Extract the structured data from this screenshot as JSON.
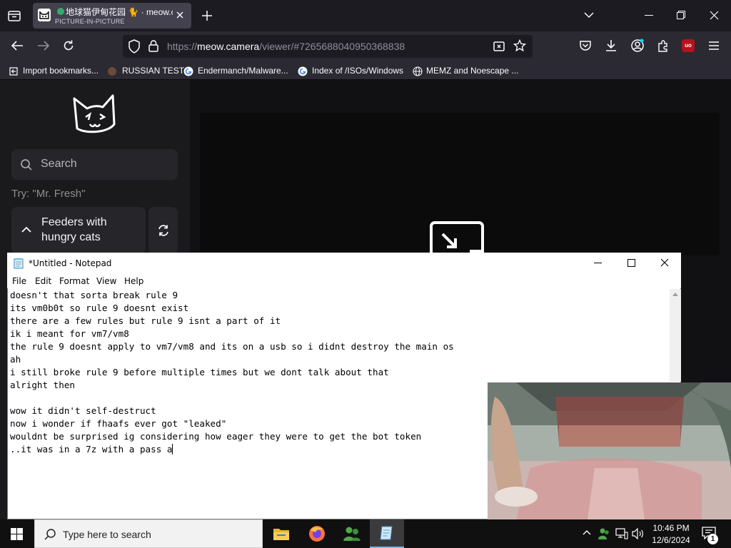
{
  "browser": {
    "tab": {
      "title": "地球猫伊甸花园 🐈 · meow.c",
      "subtitle": "PICTURE-IN-PICTURE"
    },
    "url": {
      "prefix": "https://",
      "host": "meow.camera",
      "path": "/viewer/#7265688040950368838"
    },
    "bookmarks": [
      {
        "label": "Import bookmarks...",
        "icon": "import-icon"
      },
      {
        "label": "RUSSIAN TEST",
        "icon": "globe-icon"
      },
      {
        "label": "Endermanch/Malware...",
        "icon": "google-icon"
      },
      {
        "label": "Index of /ISOs/Windows",
        "icon": "google-icon"
      },
      {
        "label": "MEMZ and Noescape ...",
        "icon": "globe-icon"
      }
    ]
  },
  "site": {
    "search_placeholder": "Search",
    "hint": "Try: \"Mr. Fresh\"",
    "feeders_label": "Feeders with hungry cats"
  },
  "notepad": {
    "title": "*Untitled - Notepad",
    "menu": [
      "File",
      "Edit",
      "Format",
      "View",
      "Help"
    ],
    "lines": [
      "doesn't that sorta break rule 9",
      "its vm0b0t so rule 9 doesnt exist",
      "there are a few rules but rule 9 isnt a part of it",
      "ik i meant for vm7/vm8",
      "the rule 9 doesnt apply to vm7/vm8 and its on a usb so i didnt destroy the main os",
      "ah",
      "i still broke rule 9 before multiple times but we dont talk about that",
      "alright then",
      "",
      "wow it didn't self-destruct",
      "now i wonder if fhaafs ever got \"leaked\"",
      "wouldnt be surprised ig considering how eager they were to get the bot token",
      "..it was in a 7z with a pass a"
    ]
  },
  "taskbar": {
    "search_placeholder": "Type here to search",
    "time": "10:46 PM",
    "date": "12/6/2024",
    "notification_count": "1"
  },
  "colors": {
    "browser_bg": "#1c1b22",
    "toolbar": "#2b2a33",
    "taskbar": "#101011",
    "ublock_red": "#b5121b"
  }
}
